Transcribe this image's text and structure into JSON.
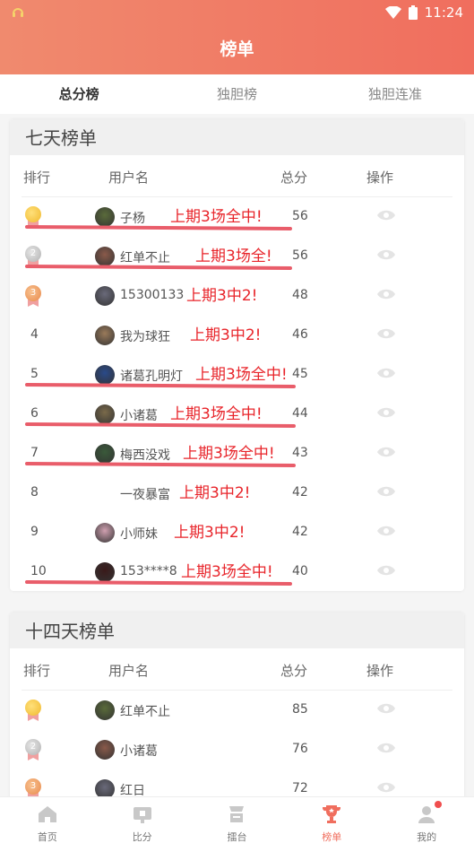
{
  "status": {
    "time": "11:24"
  },
  "header": {
    "title": "榜单"
  },
  "tabs": [
    {
      "label": "总分榜",
      "active": true
    },
    {
      "label": "独胆榜",
      "active": false
    },
    {
      "label": "独胆连准",
      "active": false
    }
  ],
  "columns": {
    "rank": "排行",
    "user": "用户名",
    "score": "总分",
    "action": "操作"
  },
  "seven_day": {
    "title": "七天榜单",
    "rows": [
      {
        "rank": "1",
        "medal": "gold",
        "name": "子杨",
        "score": "56",
        "note": "上期3场全中!",
        "struck": true
      },
      {
        "rank": "2",
        "medal": "silver",
        "name": "红单不止",
        "score": "56",
        "note": "上期3场全!",
        "struck": true
      },
      {
        "rank": "3",
        "medal": "bronze",
        "name": "15300133",
        "score": "48",
        "note": "上期3中2!",
        "struck": false
      },
      {
        "rank": "4",
        "medal": "",
        "name": "我为球狂",
        "score": "46",
        "note": "上期3中2!",
        "struck": false
      },
      {
        "rank": "5",
        "medal": "",
        "name": "诸葛孔明灯",
        "score": "45",
        "note": "上期3场全中!",
        "struck": true
      },
      {
        "rank": "6",
        "medal": "",
        "name": "小诸葛",
        "score": "44",
        "note": "上期3场全中!",
        "struck": true
      },
      {
        "rank": "7",
        "medal": "",
        "name": "梅西没戏",
        "score": "43",
        "note": "上期3场全中!",
        "struck": true
      },
      {
        "rank": "8",
        "medal": "",
        "name": "一夜暴富",
        "score": "42",
        "note": "上期3中2!",
        "struck": false
      },
      {
        "rank": "9",
        "medal": "",
        "name": "小师妹",
        "score": "42",
        "note": "上期3中2!",
        "struck": false
      },
      {
        "rank": "10",
        "medal": "",
        "name": "153****8",
        "score": "40",
        "note": "上期3场全中!",
        "struck": true
      }
    ]
  },
  "fourteen_day": {
    "title": "十四天榜单",
    "rows": [
      {
        "rank": "1",
        "medal": "gold",
        "name": "红单不止",
        "score": "85"
      },
      {
        "rank": "2",
        "medal": "silver",
        "name": "小诸葛",
        "score": "76"
      },
      {
        "rank": "3",
        "medal": "bronze",
        "name": "红日",
        "score": "72"
      }
    ]
  },
  "nav": [
    {
      "label": "首页",
      "icon": "home-icon"
    },
    {
      "label": "比分",
      "icon": "score-icon"
    },
    {
      "label": "擂台",
      "icon": "arena-icon"
    },
    {
      "label": "榜单",
      "icon": "trophy-icon",
      "active": true
    },
    {
      "label": "我的",
      "icon": "user-icon"
    }
  ],
  "colors": {
    "accent": "#f06e5e",
    "handwriting": "#e8242a",
    "strike": "#e95d6a"
  }
}
